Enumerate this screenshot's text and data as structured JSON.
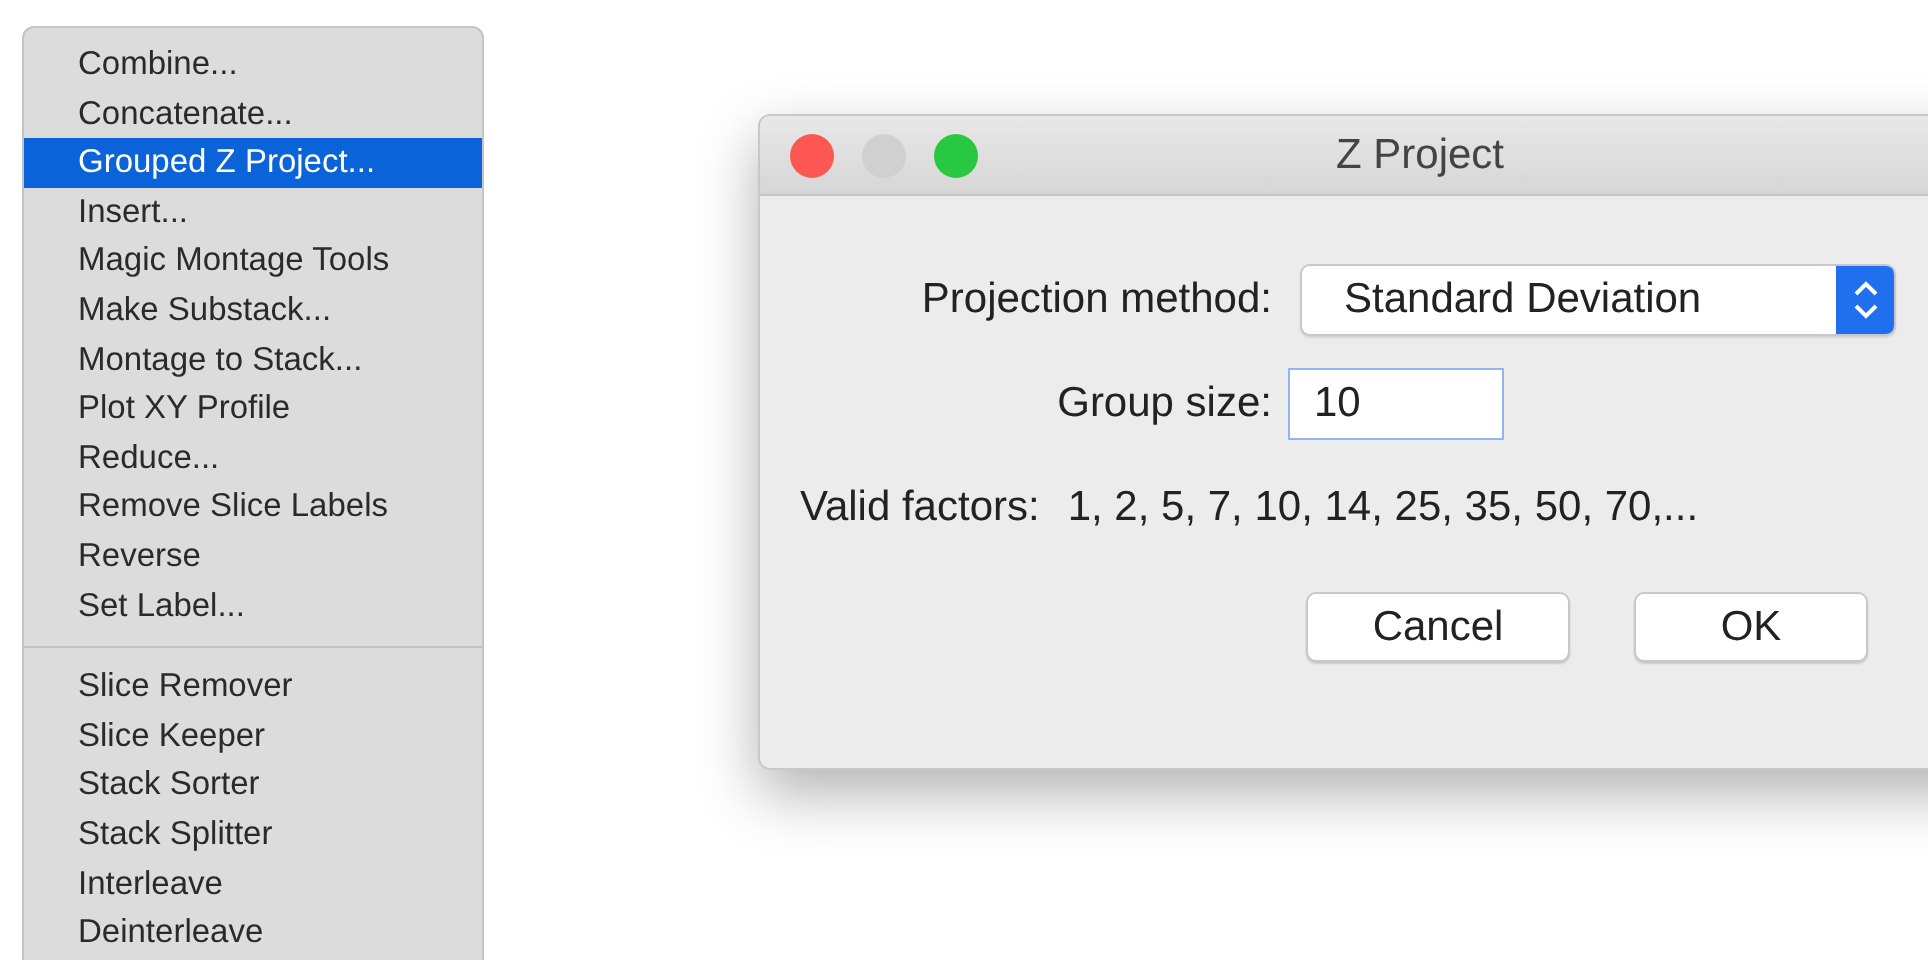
{
  "menu": {
    "sections": [
      {
        "items": [
          {
            "label": "Combine...",
            "selected": false
          },
          {
            "label": "Concatenate...",
            "selected": false
          },
          {
            "label": "Grouped Z Project...",
            "selected": true
          },
          {
            "label": "Insert...",
            "selected": false
          },
          {
            "label": "Magic Montage Tools",
            "selected": false
          },
          {
            "label": "Make Substack...",
            "selected": false
          },
          {
            "label": "Montage to Stack...",
            "selected": false
          },
          {
            "label": "Plot XY Profile",
            "selected": false
          },
          {
            "label": "Reduce...",
            "selected": false
          },
          {
            "label": "Remove Slice Labels",
            "selected": false
          },
          {
            "label": "Reverse",
            "selected": false
          },
          {
            "label": "Set Label...",
            "selected": false
          }
        ]
      },
      {
        "items": [
          {
            "label": "Slice Remover",
            "selected": false
          },
          {
            "label": "Slice Keeper",
            "selected": false
          },
          {
            "label": "Stack Sorter",
            "selected": false
          },
          {
            "label": "Stack Splitter",
            "selected": false
          },
          {
            "label": "Interleave",
            "selected": false
          },
          {
            "label": "Deinterleave",
            "selected": false
          }
        ]
      }
    ]
  },
  "dialog": {
    "title": "Z Project",
    "window_controls": [
      {
        "color": "#fc5753"
      },
      {
        "color": "#d0d0d0"
      },
      {
        "color": "#28c840"
      }
    ],
    "projection_method": {
      "label": "Projection method:",
      "value": "Standard Deviation"
    },
    "group_size": {
      "label": "Group size:",
      "value": "10"
    },
    "valid_factors": {
      "label": "Valid factors:",
      "value": "1, 2, 5, 7, 10, 14, 25, 35, 50, 70,..."
    },
    "buttons": [
      {
        "label": "Cancel",
        "kind": "cancel"
      },
      {
        "label": "OK",
        "kind": "ok"
      }
    ]
  }
}
